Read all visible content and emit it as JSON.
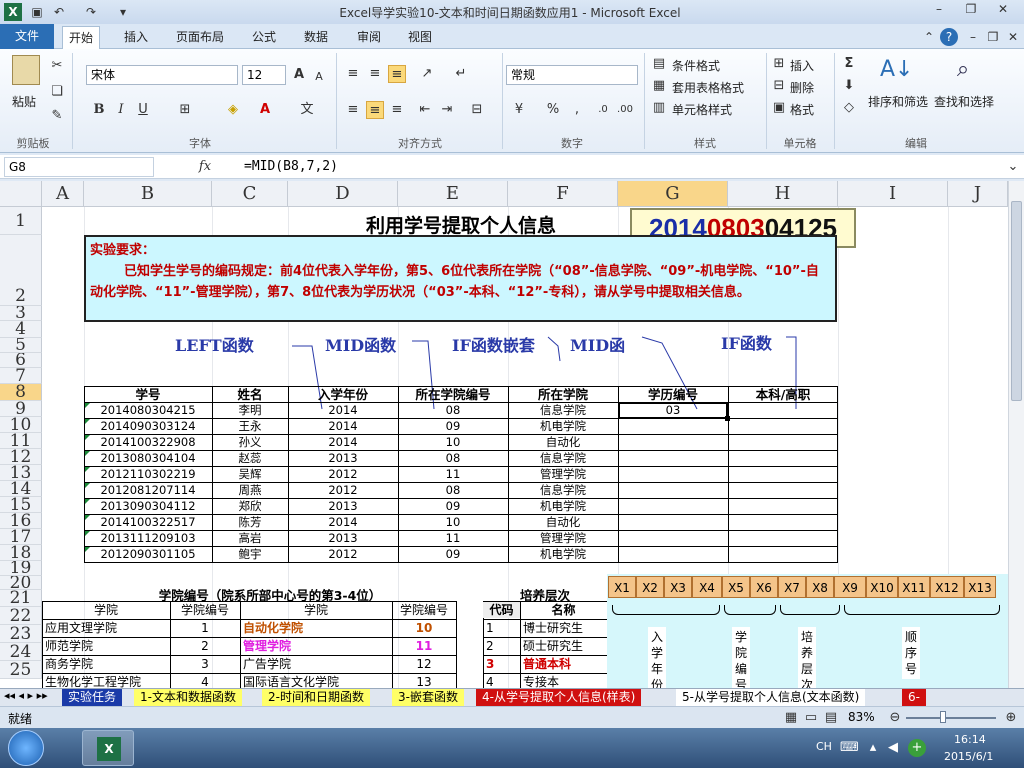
{
  "window": {
    "title": "Excel导学实验10-文本和时间日期函数应用1 - Microsoft Excel"
  },
  "tabs": [
    "文件",
    "开始",
    "插入",
    "页面布局",
    "公式",
    "数据",
    "审阅",
    "视图"
  ],
  "ribbon": {
    "paste": "粘贴",
    "clipboard": "剪贴板",
    "font_group": "字体",
    "font_name": "宋体",
    "font_size": "12",
    "align_group": "对齐方式",
    "number_format": "常规",
    "number_group": "数字",
    "cond_format": "条件格式",
    "table_format": "套用表格格式",
    "cell_style": "单元格样式",
    "styles_group": "样式",
    "insert": "插入",
    "delete": "删除",
    "format": "格式",
    "cells_group": "单元格",
    "sort": "排序和筛选",
    "find": "查找和选择",
    "edit_group": "编辑",
    "bold": "B",
    "italic": "I",
    "underline": "U",
    "percent": "%",
    "fx": "fx"
  },
  "formula_bar": {
    "name_box": "G8",
    "formula": "=MID(B8,7,2)"
  },
  "columns": [
    "A",
    "B",
    "C",
    "D",
    "E",
    "F",
    "G",
    "H",
    "I",
    "J"
  ],
  "rows": [
    "1",
    "2",
    "3",
    "4",
    "5",
    "6",
    "7",
    "8",
    "9",
    "10",
    "11",
    "12",
    "13",
    "14",
    "15",
    "16",
    "17",
    "18",
    "19",
    "20",
    "21",
    "22",
    "23",
    "24",
    "25"
  ],
  "sheet": {
    "title": "利用学号提取个人信息",
    "id_display": {
      "p1": "2014",
      "p2": "0803",
      "p3": "04125"
    },
    "req_title": "实验要求：",
    "req_text": "已知学生学号的编码规定：前4位代表入学年份，第5、6位代表所在学院（“08”-信息学院、“09”-机电学院、“10”-自动化学院、“11”-管理学院），第7、8位代表为学历状况（“03”-本科、“12”-专科），请从学号中提取相关信息。",
    "annotations": [
      "LEFT函数",
      "MID函数",
      "IF函数嵌套",
      "MID函",
      "IF函数"
    ],
    "headers": [
      "学号",
      "姓名",
      "入学年份",
      "所在学院编号",
      "所在学院",
      "学历编号",
      "本科/高职"
    ],
    "data": [
      [
        "2014080304215",
        "李明",
        "2014",
        "08",
        "信息学院",
        "03",
        ""
      ],
      [
        "2014090303124",
        "王永",
        "2014",
        "09",
        "机电学院",
        "",
        ""
      ],
      [
        "2014100322908",
        "孙义",
        "2014",
        "10",
        "自动化",
        "",
        ""
      ],
      [
        "2013080304104",
        "赵蕊",
        "2013",
        "08",
        "信息学院",
        "",
        ""
      ],
      [
        "2012110302219",
        "吴辉",
        "2012",
        "11",
        "管理学院",
        "",
        ""
      ],
      [
        "2012081207114",
        "周燕",
        "2012",
        "08",
        "信息学院",
        "",
        ""
      ],
      [
        "2013090304112",
        "郑欣",
        "2013",
        "09",
        "机电学院",
        "",
        ""
      ],
      [
        "2014100322517",
        "陈芳",
        "2014",
        "10",
        "自动化",
        "",
        ""
      ],
      [
        "2013111209103",
        "高岩",
        "2013",
        "11",
        "管理学院",
        "",
        ""
      ],
      [
        "2012090301105",
        "鲍宇",
        "2012",
        "09",
        "机电学院",
        "",
        ""
      ]
    ],
    "college_title": "学院编号（院系所部中心号的第3-4位）",
    "college_headers": [
      "学院",
      "学院编号",
      "学院",
      "学院编号"
    ],
    "college_rows": [
      [
        "应用文理学院",
        "1",
        "自动化学院",
        "10"
      ],
      [
        "师范学院",
        "2",
        "管理学院",
        "11"
      ],
      [
        "商务学院",
        "3",
        "广告学院",
        "12"
      ],
      [
        "生物化学工程学院",
        "4",
        "国际语言文化学院",
        "13"
      ]
    ],
    "level_title": "培养层次",
    "level_headers": [
      "代码",
      "名称"
    ],
    "level_rows": [
      [
        "1",
        "博士研究生"
      ],
      [
        "2",
        "硕士研究生"
      ],
      [
        "3",
        "普通本科"
      ],
      [
        "4",
        "专接本"
      ]
    ],
    "x_labels": [
      "X1",
      "X2",
      "X3",
      "X4",
      "X5",
      "X6",
      "X7",
      "X8",
      "X9",
      "X10",
      "X11",
      "X12",
      "X13"
    ],
    "x_groups": [
      "入学年份",
      "学院编号",
      "培养层次",
      "顺序号"
    ]
  },
  "sheet_tabs": [
    "实验任务",
    "1-文本和数据函数",
    "2-时间和日期函数",
    "3-嵌套函数",
    "4-从学号提取个人信息(样表)",
    "5-从学号提取个人信息(文本函数)",
    "6-"
  ],
  "status": {
    "ready": "就绪",
    "zoom": "83%"
  },
  "taskbar": {
    "lang": "CH",
    "time": "16:14",
    "date": "2015/6/1"
  },
  "colors": {
    "accent": "#2b6eb5",
    "title_red": "#c00000",
    "annot_blue": "#2a3aa8",
    "pink": "#e020e0",
    "orange": "#c05000"
  }
}
